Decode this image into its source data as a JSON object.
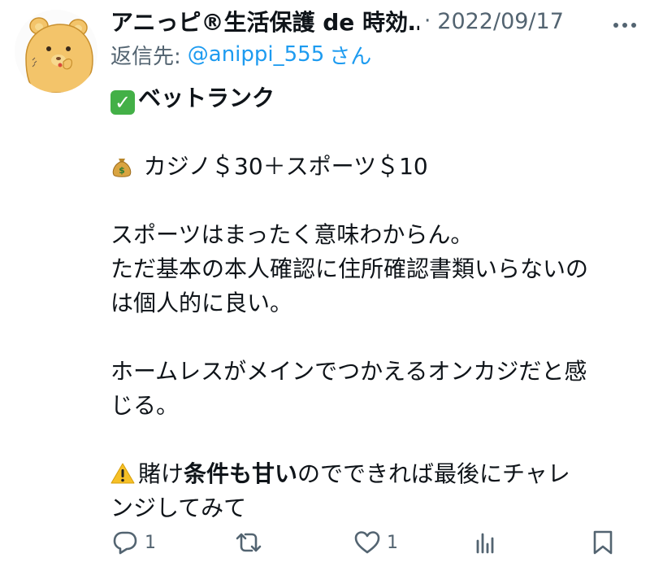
{
  "author": {
    "display_name": "アニっピ®生活保護 de 時効…",
    "separator": "·",
    "date": "2022/09/17",
    "avatar_icon": "bear-character-icon"
  },
  "reply": {
    "prefix": "返信先:",
    "handle": "@anippi_555",
    "suffix": "さん"
  },
  "body": {
    "line1": "ベットランク",
    "line2": "カジノ＄30＋スポーツ＄10",
    "line3": "スポーツはまったく意味わからん。",
    "line4": "ただ基本の本人確認に住所確認書類いらないの",
    "line5": "は個人的に良い。",
    "line6": "ホームレスがメインでつかえるオンカジだと感",
    "line7": "じる。",
    "line8_a": "賭け",
    "line8_bold": "条件も甘い",
    "line8_b": "のでできれば最後にチャレ",
    "line9": "ンジしてみて"
  },
  "actions": {
    "reply_count": "1",
    "retweet_count": "",
    "like_count": "1"
  },
  "icons": {
    "more": "more-dots-icon",
    "check": "check-mark-emoji",
    "moneybag": "money-bag-emoji",
    "warning": "warning-emoji",
    "reply": "reply-icon",
    "retweet": "retweet-icon",
    "like": "heart-icon",
    "views": "views-chart-icon",
    "bookmark": "bookmark-icon"
  },
  "colors": {
    "text": "#0f1419",
    "secondary": "#536471",
    "link": "#1d9bf0",
    "check_green": "#43b047"
  }
}
